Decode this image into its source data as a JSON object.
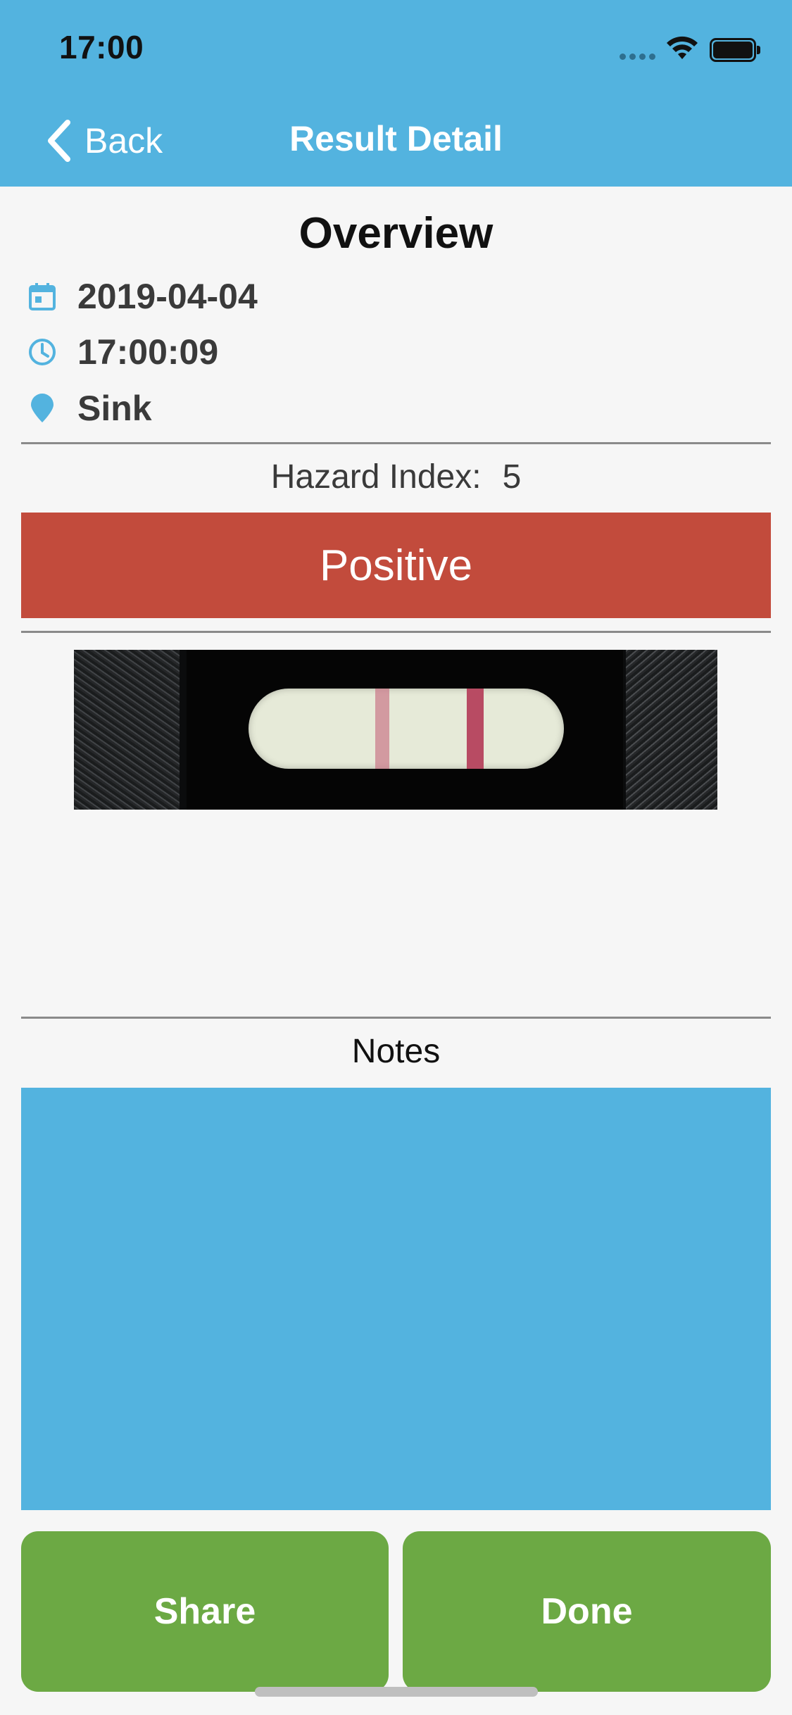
{
  "status_bar": {
    "time": "17:00"
  },
  "nav": {
    "back_label": "Back",
    "title": "Result Detail"
  },
  "overview": {
    "title": "Overview",
    "date": "2019-04-04",
    "time": "17:00:09",
    "location": "Sink",
    "icons": {
      "date": "calendar-icon",
      "time": "clock-icon",
      "location": "map-pin-icon"
    }
  },
  "hazard": {
    "label": "Hazard Index:",
    "value": "5"
  },
  "result": {
    "label": "Positive",
    "color": "#c24b3c"
  },
  "notes": {
    "label": "Notes",
    "value": ""
  },
  "actions": {
    "share_label": "Share",
    "done_label": "Done"
  },
  "colors": {
    "accent": "#53b3df",
    "button": "#6ca944",
    "positive": "#c24b3c"
  }
}
